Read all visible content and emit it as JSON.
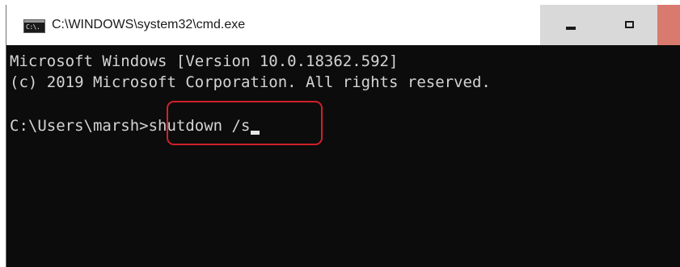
{
  "window": {
    "title": "C:\\WINDOWS\\system32\\cmd.exe",
    "icon": "command-prompt-icon",
    "icon_glyph": "C:\\."
  },
  "controls": {
    "minimize": "minimize-icon",
    "maximize": "maximize-icon",
    "close": "close-icon"
  },
  "console": {
    "line1": "Microsoft Windows [Version 10.0.18362.592]",
    "line2": "(c) 2019 Microsoft Corporation. All rights reserved.",
    "prompt": "C:\\Users\\marsh>",
    "command": "shutdown /s"
  },
  "colors": {
    "console_background": "#0c0c0c",
    "console_text": "#d4d4d4",
    "highlight_border": "#d0202a",
    "close_button": "#d97a6e"
  }
}
